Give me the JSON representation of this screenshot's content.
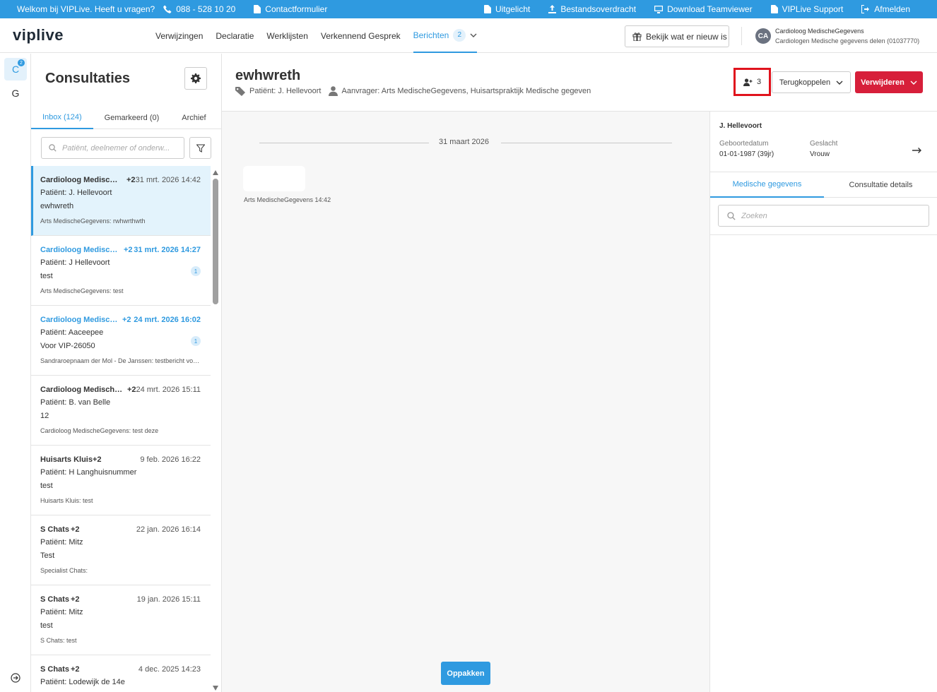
{
  "topbar": {
    "welcome": "Welkom bij VIPLive. Heeft u vragen?",
    "phone": "088 - 528 10 20",
    "contact": "Contactformulier",
    "links": [
      "Uitgelicht",
      "Bestandsoverdracht",
      "Download Teamviewer",
      "VIPLive Support",
      "Afmelden"
    ]
  },
  "nav": {
    "logo": "viplive",
    "links": [
      "Verwijzingen",
      "Declaratie",
      "Werklijsten",
      "Verkennend Gesprek",
      "Berichten"
    ],
    "berichten_count": "2",
    "whatsnew": "Bekijk wat er nieuw is",
    "avatar": "CA",
    "user_name": "Cardioloog MedischeGegevens",
    "user_org": "Cardiologen Medische gegevens delen (01037770)"
  },
  "rail": {
    "items": [
      "C",
      "G"
    ],
    "badge": "2"
  },
  "panel": {
    "title": "Consultaties",
    "tabs": [
      "Inbox (124)",
      "Gemarkeerd (0)",
      "Archief"
    ],
    "search_placeholder": "Patiënt, deelnemer of onderw...",
    "items": [
      {
        "from": "Cardioloog Medisch...",
        "extra": "+2",
        "date": "31 mrt. 2026 14:42",
        "patient": "Patiënt: J. Hellevoort",
        "subject": "ewhwreth",
        "preview": "Arts MedischeGegevens: rwhwrthwth",
        "badge": ""
      },
      {
        "from": "Cardioloog Medisch...",
        "extra": "+2",
        "date": "31 mrt. 2026 14:27",
        "patient": "Patiënt: J Hellevoort",
        "subject": "test",
        "preview": "Arts MedischeGegevens: test",
        "badge": "1"
      },
      {
        "from": "Cardioloog Medisch...",
        "extra": "+2",
        "date": "24 mrt. 2026 16:02",
        "patient": "Patiënt: Aaceepee",
        "subject": "Voor VIP-26050",
        "preview": "Sandraroepnaam der Mol - De Janssen: testbericht voor VIP-26050",
        "badge": "1"
      },
      {
        "from": "Cardioloog Medische...",
        "extra": "+2",
        "date": "24 mrt. 2026 15:11",
        "patient": "Patiënt: B. van Belle",
        "subject": "12",
        "preview": "Cardioloog MedischeGegevens: test deze",
        "badge": ""
      },
      {
        "from": "Huisarts Kluis",
        "extra": "+2",
        "date": "9 feb. 2026 16:22",
        "patient": "Patiënt: H Langhuisnummer",
        "subject": "test",
        "preview": "Huisarts Kluis: test",
        "badge": ""
      },
      {
        "from": "S Chats",
        "extra": "+2",
        "date": "22 jan. 2026 16:14",
        "patient": "Patiënt: Mitz",
        "subject": "Test",
        "preview": "Specialist Chats:",
        "badge": ""
      },
      {
        "from": "S Chats",
        "extra": "+2",
        "date": "19 jan. 2026 15:11",
        "patient": "Patiënt: Mitz",
        "subject": "test",
        "preview": "S Chats: test",
        "badge": ""
      },
      {
        "from": "S Chats",
        "extra": "+2",
        "date": "4 dec. 2025 14:23",
        "patient": "Patiënt: Lodewijk de 14e",
        "subject": "",
        "preview": "",
        "badge": ""
      }
    ]
  },
  "conversation": {
    "title": "ewhwreth",
    "patient": "Patiënt: J. Hellevoort",
    "requester": "Aanvrager: Arts MedischeGegevens, Huisartspraktijk Medische gegeven",
    "participants_count": "3",
    "feedback_label": "Terugkoppelen",
    "delete_label": "Verwijderen",
    "date_divider": "31 maart 2026",
    "message_meta": "Arts MedischeGegevens 14:42",
    "pickup_label": "Oppakken"
  },
  "details": {
    "patient_name": "J. Hellevoort",
    "dob_label": "Geboortedatum",
    "dob_value": "01-01-1987 (39jr)",
    "sex_label": "Geslacht",
    "sex_value": "Vrouw",
    "tabs": [
      "Medische gegevens",
      "Consultatie details"
    ],
    "search_placeholder": "Zoeken"
  },
  "colors": {
    "accent": "#2f9ae0",
    "danger": "#d71f3a",
    "highlight_box": "#e0131d"
  }
}
